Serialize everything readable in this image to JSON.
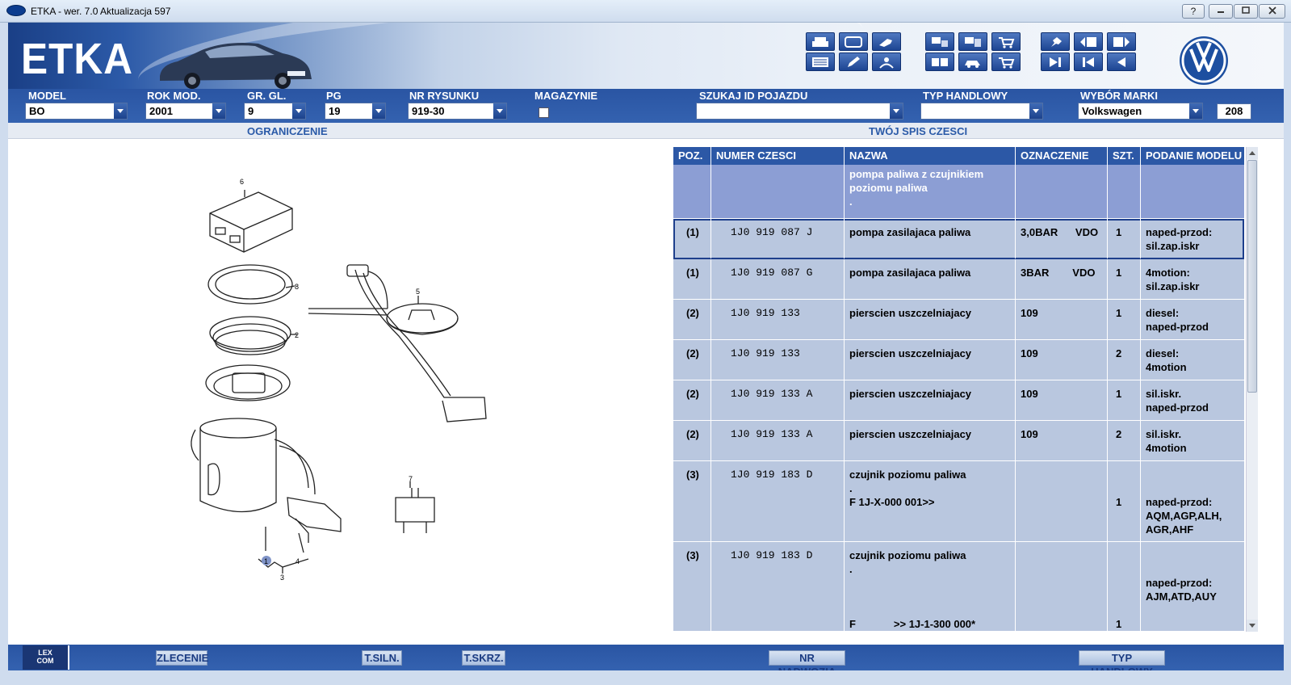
{
  "window": {
    "title": "ETKA - wer. 7.0 Aktualizacja 597",
    "help": "?",
    "min": "▭",
    "max": "□",
    "close": "☒"
  },
  "header": {
    "logo": "ETKA"
  },
  "selectors": {
    "model": {
      "label": "MODEL",
      "value": "BO"
    },
    "rok_mod": {
      "label": "ROK MOD.",
      "value": "2001"
    },
    "gr_gl": {
      "label": "GR. GL.",
      "value": "9"
    },
    "pg": {
      "label": "PG",
      "value": "19"
    },
    "nr_rysunku": {
      "label": "NR RYSUNKU",
      "value": "919-30"
    },
    "magazynie": {
      "label": "MAGAZYNIE"
    },
    "szukaj": {
      "label": "SZUKAJ ID POJAZDU",
      "value": ""
    },
    "typ_handlowy": {
      "label": "TYP HANDLOWY",
      "value": ""
    },
    "wybor_marki": {
      "label": "WYBÓR MARKI",
      "value": "Volkswagen"
    },
    "count": "208"
  },
  "sections": {
    "left": "OGRANICZENIE",
    "right": "TWÓJ SPIS CZESCI"
  },
  "diagram": {
    "callouts": [
      "6",
      "8",
      "2",
      "5",
      "7",
      "1",
      "4",
      "3"
    ]
  },
  "table": {
    "columns": [
      "POZ.",
      "NUMER CZESCI",
      "NAZWA",
      "OZNACZENIE",
      "SZT.",
      "PODANIE MODELU"
    ],
    "heading_row": {
      "nazwa": "pompa paliwa z czujnikiem\npoziomu paliwa\n."
    },
    "rows": [
      {
        "poz": "(1)",
        "numer": "1J0 919 087 J",
        "nazwa": "pompa zasilajaca paliwa",
        "oznaczenie": "3,0BAR      VDO",
        "szt": "1",
        "model": "naped-przod:\nsil.zap.iskr"
      },
      {
        "poz": "(1)",
        "numer": "1J0 919 087 G",
        "nazwa": "pompa zasilajaca paliwa",
        "oznaczenie": "3BAR        VDO",
        "szt": "1",
        "model": "4motion:\nsil.zap.iskr"
      },
      {
        "poz": "(2)",
        "numer": "1J0 919 133",
        "nazwa": "pierscien uszczelniajacy",
        "oznaczenie": "109",
        "szt": "1",
        "model": "diesel:\nnaped-przod"
      },
      {
        "poz": "(2)",
        "numer": "1J0 919 133",
        "nazwa": "pierscien uszczelniajacy",
        "oznaczenie": "109",
        "szt": "2",
        "model": "diesel:\n4motion"
      },
      {
        "poz": "(2)",
        "numer": "1J0 919 133 A",
        "nazwa": "pierscien uszczelniajacy",
        "oznaczenie": "109",
        "szt": "1",
        "model": "sil.iskr.\nnaped-przod"
      },
      {
        "poz": "(2)",
        "numer": "1J0 919 133 A",
        "nazwa": "pierscien uszczelniajacy",
        "oznaczenie": "109",
        "szt": "2",
        "model": "sil.iskr.\n4motion"
      },
      {
        "poz": "(3)",
        "numer": "1J0 919 183 D",
        "nazwa": "czujnik poziomu paliwa\n.\nF 1J-X-000 001>>",
        "oznaczenie": "",
        "szt": "\n\n1",
        "model": "\n\nnaped-przod:\nAQM,AGP,ALH,\nAGR,AHF"
      },
      {
        "poz": "(3)",
        "numer": "1J0 919 183 D",
        "nazwa": "czujnik poziomu paliwa\n.\n\n\n\nF             >> 1J-1-300 000*",
        "oznaczenie": "",
        "szt": "\n\n\n\n\n1",
        "model": "\n\nnaped-przod:\nAJM,ATD,AUY"
      }
    ]
  },
  "bottom": {
    "lexcom": "LEX\nCOM",
    "buttons": [
      "ZLECENIE",
      "T.SILN.",
      "T.SKRZ.",
      "NR NADWOZIA",
      "TYP HANDLOWY"
    ]
  },
  "colors": {
    "primary": "#2c58a6",
    "row": "#b9c7df",
    "headrow": "#8c9ed4"
  }
}
